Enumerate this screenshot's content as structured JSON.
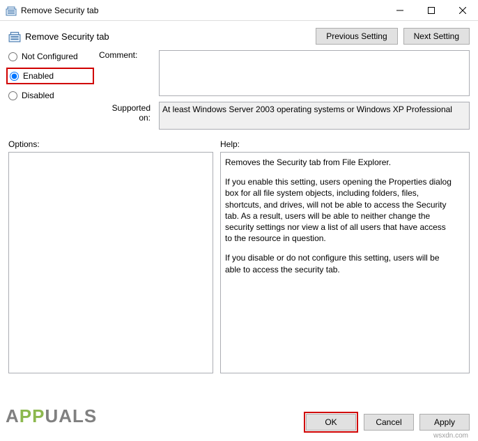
{
  "window": {
    "title": "Remove Security tab"
  },
  "header": {
    "title": "Remove Security tab",
    "previous_setting": "Previous Setting",
    "next_setting": "Next Setting"
  },
  "state_options": {
    "not_configured": "Not Configured",
    "enabled": "Enabled",
    "disabled": "Disabled",
    "selected": "enabled"
  },
  "labels": {
    "comment": "Comment:",
    "supported_on": "Supported on:",
    "options": "Options:",
    "help": "Help:"
  },
  "comment_value": "",
  "supported_on_value": "At least Windows Server 2003 operating systems or Windows XP Professional",
  "help": {
    "p1": "Removes the Security tab from File Explorer.",
    "p2": "If you enable this setting, users opening the Properties dialog box for all file system objects, including folders, files, shortcuts, and drives, will not be able to access the Security tab. As a result, users will be able to neither change the security settings nor view a list of all users that have access to the resource in question.",
    "p3": "If you disable or do not configure this setting, users will be able to access the security tab."
  },
  "buttons": {
    "ok": "OK",
    "cancel": "Cancel",
    "apply": "Apply"
  },
  "watermark": {
    "brand_pre": "A",
    "brand_mid": "PP",
    "brand_post": "UALS",
    "site": "wsxdn.com"
  }
}
